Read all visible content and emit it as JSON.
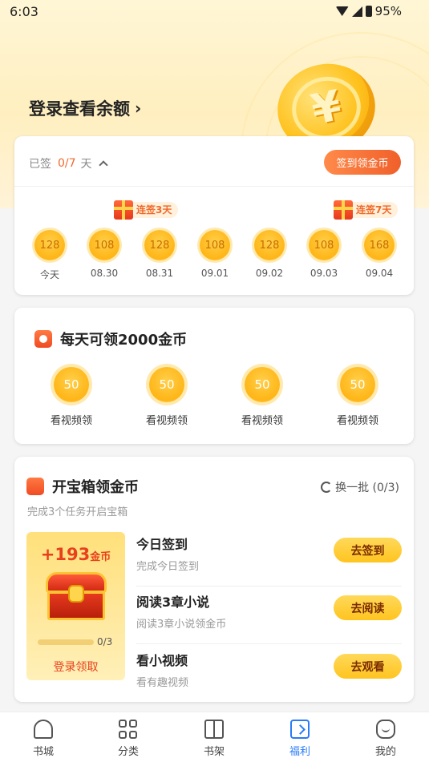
{
  "status_bar": {
    "time": "6:03",
    "battery": "95%"
  },
  "header": {
    "login_label": "登录查看余额",
    "chevron": "›"
  },
  "sign_in": {
    "status_prefix": "已签",
    "progress": "0/7",
    "status_suffix": "天",
    "button_label": "签到领金币",
    "badges": [
      {
        "label": "连签3天"
      },
      {
        "label": "连签7天"
      }
    ],
    "days": [
      {
        "coins": "128",
        "label": "今天"
      },
      {
        "coins": "108",
        "label": "08.30"
      },
      {
        "coins": "128",
        "label": "08.31"
      },
      {
        "coins": "108",
        "label": "09.01"
      },
      {
        "coins": "128",
        "label": "09.02"
      },
      {
        "coins": "108",
        "label": "09.03"
      },
      {
        "coins": "168",
        "label": "09.04"
      }
    ]
  },
  "daily": {
    "title": "每天可领2000金币",
    "items": [
      {
        "coins": "50",
        "label": "看视频领"
      },
      {
        "coins": "50",
        "label": "看视频领"
      },
      {
        "coins": "50",
        "label": "看视频领"
      },
      {
        "coins": "50",
        "label": "看视频领"
      }
    ]
  },
  "treasure": {
    "title": "开宝箱领金币",
    "refresh_label": "换一批 (0/3)",
    "subtitle": "完成3个任务开启宝箱",
    "reward_amount": "+193",
    "reward_unit": "金币",
    "progress_text": "0/3",
    "progress_fraction": 0,
    "claim_label": "登录领取",
    "tasks": [
      {
        "name": "今日签到",
        "desc": "完成今日签到",
        "button": "去签到"
      },
      {
        "name": "阅读3章小说",
        "desc": "阅读3章小说领金币",
        "button": "去阅读"
      },
      {
        "name": "看小视频",
        "desc": "看有趣视频",
        "button": "去观看"
      }
    ]
  },
  "nav": {
    "items": [
      {
        "label": "书城",
        "icon": "home-icon"
      },
      {
        "label": "分类",
        "icon": "grid-icon"
      },
      {
        "label": "书架",
        "icon": "book-icon"
      },
      {
        "label": "福利",
        "icon": "gift-icon",
        "active": true
      },
      {
        "label": "我的",
        "icon": "profile-icon"
      }
    ],
    "active_color": "#2b7cf5"
  },
  "colors": {
    "accent_orange": "#f0602a",
    "coin_gold": "#ffb516",
    "button_yellow": "#ffc41f"
  }
}
